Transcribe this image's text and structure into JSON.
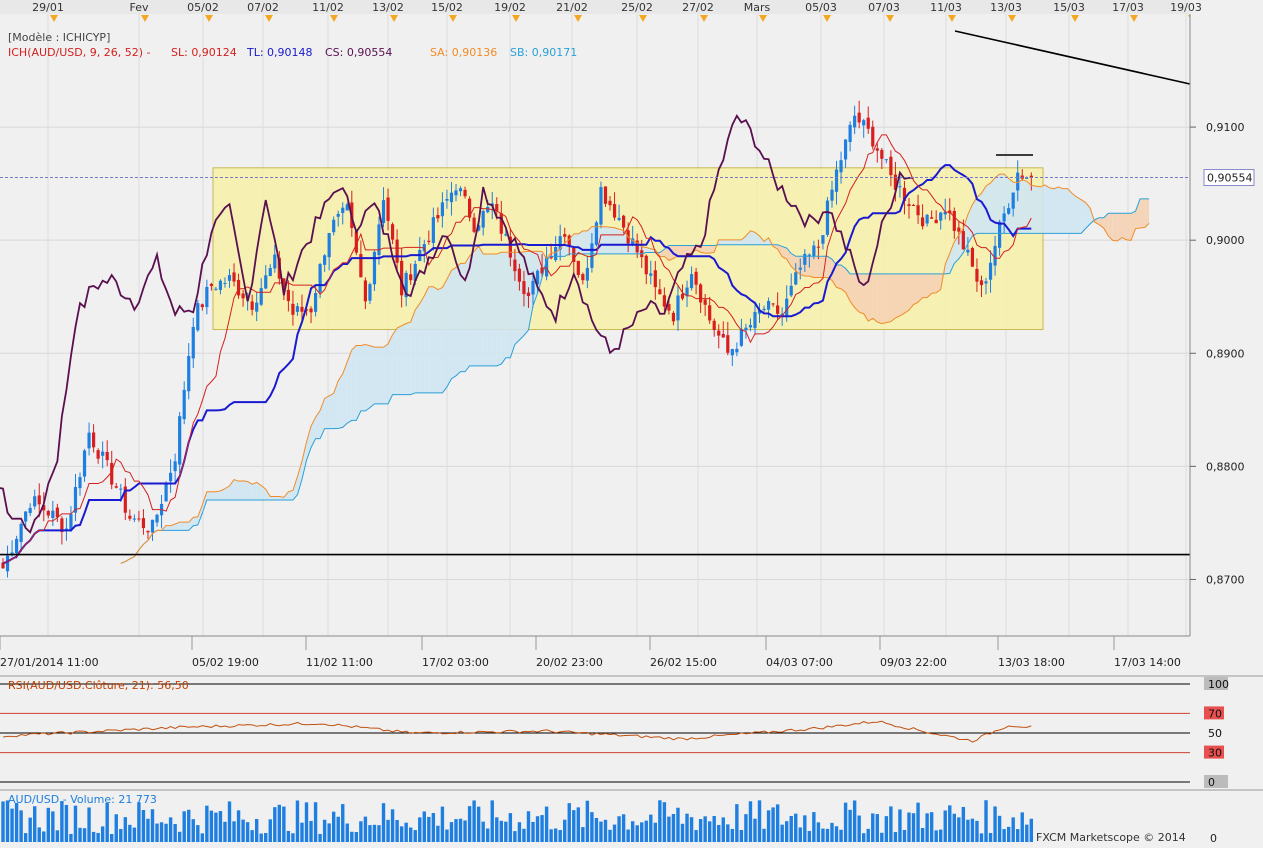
{
  "colors": {
    "background": "#f0f0f0",
    "bull": "#1e7fe0",
    "bear": "#d81e1e",
    "tenkan": "#d42020",
    "kijun": "#1a1ad0",
    "chikou": "#5a1050",
    "senkou_a": "#f08c28",
    "senkou_b": "#2aa0d8",
    "cloud_bull": "#cfe6f2",
    "cloud_bear": "#f5d2b4",
    "zone": "#f7f0a8",
    "marker": "#f5a623"
  },
  "chart_data": [
    {
      "type": "candlestick",
      "title": "[Modèle : ICHICYP]",
      "indicator_label": "ICH(AUD/USD, 9, 26, 52) -",
      "legend": [
        {
          "label": "SL: 0,90124",
          "color": "#d42020"
        },
        {
          "label": "TL: 0,90148",
          "color": "#1a1ad0"
        },
        {
          "label": "CS: 0,90554",
          "color": "#5a1050"
        },
        {
          "label": "SA: 0,90136",
          "color": "#f08c28"
        },
        {
          "label": "SB: 0,90171",
          "color": "#2aa0d8"
        }
      ],
      "ylim": [
        0.865,
        0.92
      ],
      "y_ticks": [
        0.87,
        0.88,
        0.89,
        0.9,
        0.91
      ],
      "y_tick_labels": [
        "0,8700",
        "0,8800",
        "0,8900",
        "0,9000",
        "0,9100"
      ],
      "current_price": 0.90554,
      "current_price_label": "0,90554",
      "top_dates": [
        "29/01",
        "Fev",
        "05/02",
        "07/02",
        "11/02",
        "13/02",
        "15/02",
        "19/02",
        "21/02",
        "25/02",
        "27/02",
        "Mars",
        "05/03",
        "07/03",
        "11/03",
        "13/03",
        "15/03",
        "17/03",
        "19/03"
      ],
      "bottom_dates": [
        "27/01/2014 11:00",
        "05/02 19:00",
        "11/02 11:00",
        "17/02 03:00",
        "20/02 23:00",
        "26/02 15:00",
        "04/03 07:00",
        "09/03 22:00",
        "13/03 18:00",
        "17/03 14:00"
      ],
      "support_level": 0.8722,
      "range_box": [
        0.8921,
        0.9064
      ],
      "close_anchors": [
        [
          0,
          0.871
        ],
        [
          6,
          0.877
        ],
        [
          10,
          0.876
        ],
        [
          14,
          0.8745
        ],
        [
          19,
          0.883
        ],
        [
          25,
          0.8782
        ],
        [
          28,
          0.8755
        ],
        [
          33,
          0.8745
        ],
        [
          38,
          0.881
        ],
        [
          42,
          0.893
        ],
        [
          46,
          0.896
        ],
        [
          50,
          0.8965
        ],
        [
          55,
          0.8945
        ],
        [
          60,
          0.898
        ],
        [
          64,
          0.8935
        ],
        [
          68,
          0.894
        ],
        [
          72,
          0.901
        ],
        [
          76,
          0.9025
        ],
        [
          80,
          0.8945
        ],
        [
          84,
          0.904
        ],
        [
          88,
          0.8955
        ],
        [
          92,
          0.899
        ],
        [
          96,
          0.902
        ],
        [
          100,
          0.905
        ],
        [
          104,
          0.9015
        ],
        [
          108,
          0.903
        ],
        [
          112,
          0.899
        ],
        [
          116,
          0.895
        ],
        [
          120,
          0.8985
        ],
        [
          124,
          0.901
        ],
        [
          128,
          0.896
        ],
        [
          132,
          0.9045
        ],
        [
          136,
          0.902
        ],
        [
          140,
          0.899
        ],
        [
          144,
          0.8955
        ],
        [
          148,
          0.8935
        ],
        [
          152,
          0.8975
        ],
        [
          156,
          0.893
        ],
        [
          160,
          0.89
        ],
        [
          164,
          0.892
        ],
        [
          168,
          0.894
        ],
        [
          172,
          0.8935
        ],
        [
          176,
          0.8975
        ],
        [
          180,
          0.8995
        ],
        [
          184,
          0.906
        ],
        [
          188,
          0.911
        ],
        [
          192,
          0.909
        ],
        [
          196,
          0.9055
        ],
        [
          200,
          0.9035
        ],
        [
          204,
          0.9015
        ],
        [
          208,
          0.903
        ],
        [
          212,
          0.8995
        ],
        [
          216,
          0.8955
        ],
        [
          220,
          0.901
        ],
        [
          224,
          0.906
        ],
        [
          227,
          0.9055
        ]
      ]
    },
    {
      "type": "line",
      "title": "RSI(AUD/USD.Clôture, 21): 56,50",
      "ylim": [
        0,
        100
      ],
      "levels": [
        0,
        30,
        50,
        70,
        100
      ],
      "level_labels": [
        "0",
        "30",
        "50",
        "70",
        "100"
      ],
      "values_anchor": [
        [
          0,
          47
        ],
        [
          40,
          56
        ],
        [
          70,
          60
        ],
        [
          90,
          50
        ],
        [
          120,
          52
        ],
        [
          150,
          44
        ],
        [
          180,
          55
        ],
        [
          193,
          62
        ],
        [
          205,
          50
        ],
        [
          214,
          42
        ],
        [
          222,
          58
        ],
        [
          227,
          56
        ]
      ]
    },
    {
      "type": "bar",
      "title": "AUD/USD - Volume: 21 773",
      "y_tick_labels": [
        "0"
      ],
      "credit": "FXCM Marketscope © 2014"
    }
  ]
}
